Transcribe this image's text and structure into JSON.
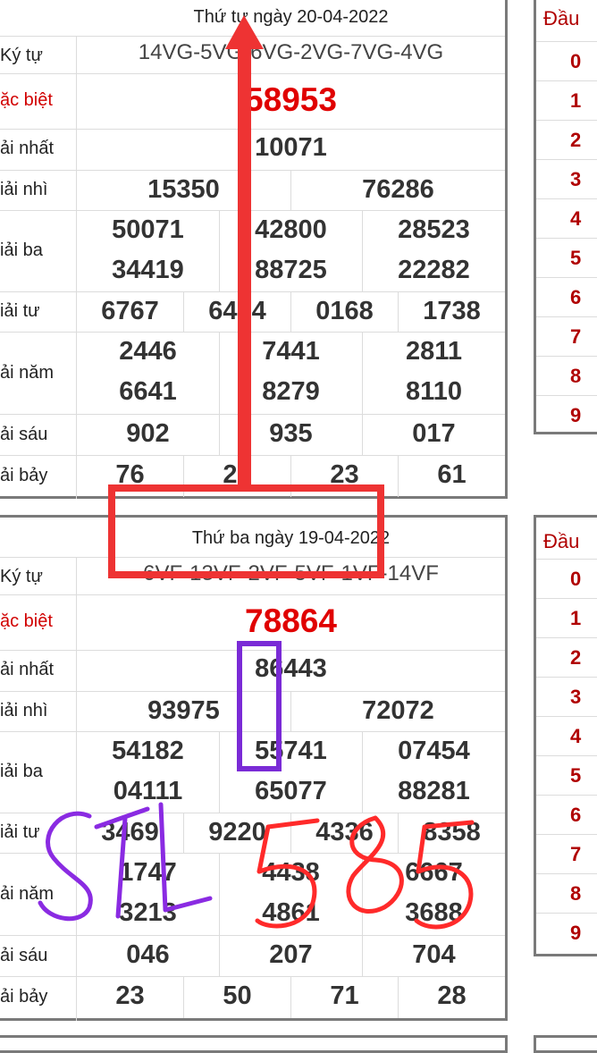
{
  "results": [
    {
      "title": "Thứ tư ngày 20-04-2022",
      "kytu": "14VG-5VG-6VG-2VG-7VG-4VG",
      "special": "58953",
      "first": "10071",
      "second": [
        "15350",
        "76286"
      ],
      "third": [
        "50071",
        "42800",
        "28523",
        "34419",
        "88725",
        "22282"
      ],
      "fourth": [
        "6767",
        "6404",
        "0168",
        "1738"
      ],
      "fifth": [
        "2446",
        "7441",
        "2811",
        "6641",
        "8279",
        "8110"
      ],
      "sixth": [
        "902",
        "935",
        "017"
      ],
      "seventh": [
        "76",
        "28",
        "23",
        "61"
      ]
    },
    {
      "title": "Thứ ba ngày 19-04-2022",
      "kytu": "6VF-13VF-2VF-5VF-1VF-14VF",
      "special": "78864",
      "first": "86443",
      "second": [
        "93975",
        "72072"
      ],
      "third": [
        "54182",
        "55741",
        "07454",
        "04111",
        "65077",
        "88281"
      ],
      "fourth": [
        "3469",
        "9220",
        "4336",
        "8358"
      ],
      "fifth": [
        "1747",
        "4438",
        "6667",
        "3213",
        "4861",
        "3688"
      ],
      "sixth": [
        "046",
        "207",
        "704"
      ],
      "seventh": [
        "23",
        "50",
        "71",
        "28"
      ]
    }
  ],
  "labels": {
    "kytu": "Ký tự",
    "special": "ặc biệt",
    "first": "ải nhất",
    "second": "iải nhì",
    "third": "iải ba",
    "fourth": "iải tư",
    "fifth": "ải năm",
    "sixth": "ải sáu",
    "seventh": "ải bảy"
  },
  "dau": {
    "header": "Đầu",
    "digits": [
      "0",
      "1",
      "2",
      "3",
      "4",
      "5",
      "6",
      "7",
      "8",
      "9"
    ]
  },
  "annotations": {
    "handwritten": [
      "STL",
      "585"
    ],
    "colors": {
      "arrow": "#ee3333",
      "box_purple": "#7a2bd6",
      "ink_purple": "#8a2be2",
      "ink_red": "#ff2a2a"
    }
  }
}
